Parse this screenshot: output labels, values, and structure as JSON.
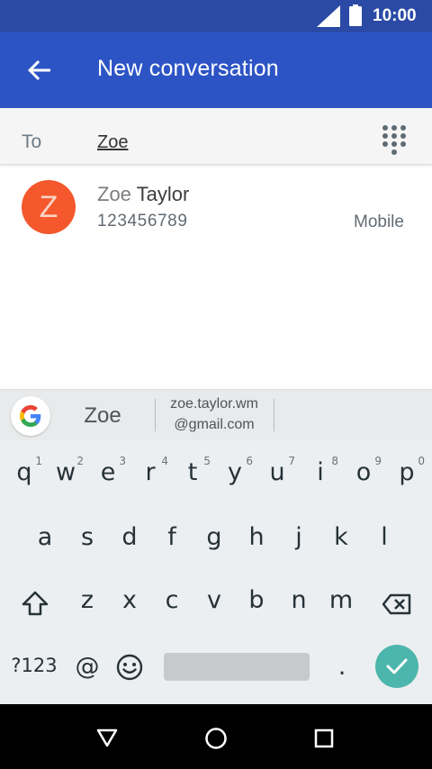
{
  "status": {
    "time": "10:00"
  },
  "header": {
    "title": "New conversation"
  },
  "recipient": {
    "to_label": "To",
    "value": "Zoe"
  },
  "contact": {
    "avatar_letter": "Z",
    "first_name": "Zoe",
    "last_name": "Taylor",
    "number": "123456789",
    "number_type": "Mobile",
    "avatar_color": "#f4582c"
  },
  "suggestions": {
    "word": "Zoe",
    "email_line1": "zoe.taylor.wm",
    "email_line2": "@gmail.com"
  },
  "keyboard": {
    "row1": [
      {
        "key": "q",
        "hint": "1"
      },
      {
        "key": "w",
        "hint": "2"
      },
      {
        "key": "e",
        "hint": "3"
      },
      {
        "key": "r",
        "hint": "4"
      },
      {
        "key": "t",
        "hint": "5"
      },
      {
        "key": "y",
        "hint": "6"
      },
      {
        "key": "u",
        "hint": "7"
      },
      {
        "key": "i",
        "hint": "8"
      },
      {
        "key": "o",
        "hint": "9"
      },
      {
        "key": "p",
        "hint": "0"
      }
    ],
    "row2": [
      "a",
      "s",
      "d",
      "f",
      "g",
      "h",
      "j",
      "k",
      "l"
    ],
    "row3": [
      "z",
      "x",
      "c",
      "v",
      "b",
      "n",
      "m"
    ],
    "symbols_label": "?123",
    "at_label": "@",
    "period_label": "."
  },
  "colors": {
    "app_bar": "#2d54c5",
    "status_bar": "#2a4aa5",
    "accent": "#4db6ac"
  },
  "icons": [
    "back-arrow-icon",
    "dialpad-icon",
    "google-icon",
    "shift-icon",
    "backspace-icon",
    "emoji-icon",
    "check-icon",
    "back-nav-icon",
    "home-nav-icon",
    "recents-nav-icon",
    "signal-icon",
    "battery-icon"
  ]
}
